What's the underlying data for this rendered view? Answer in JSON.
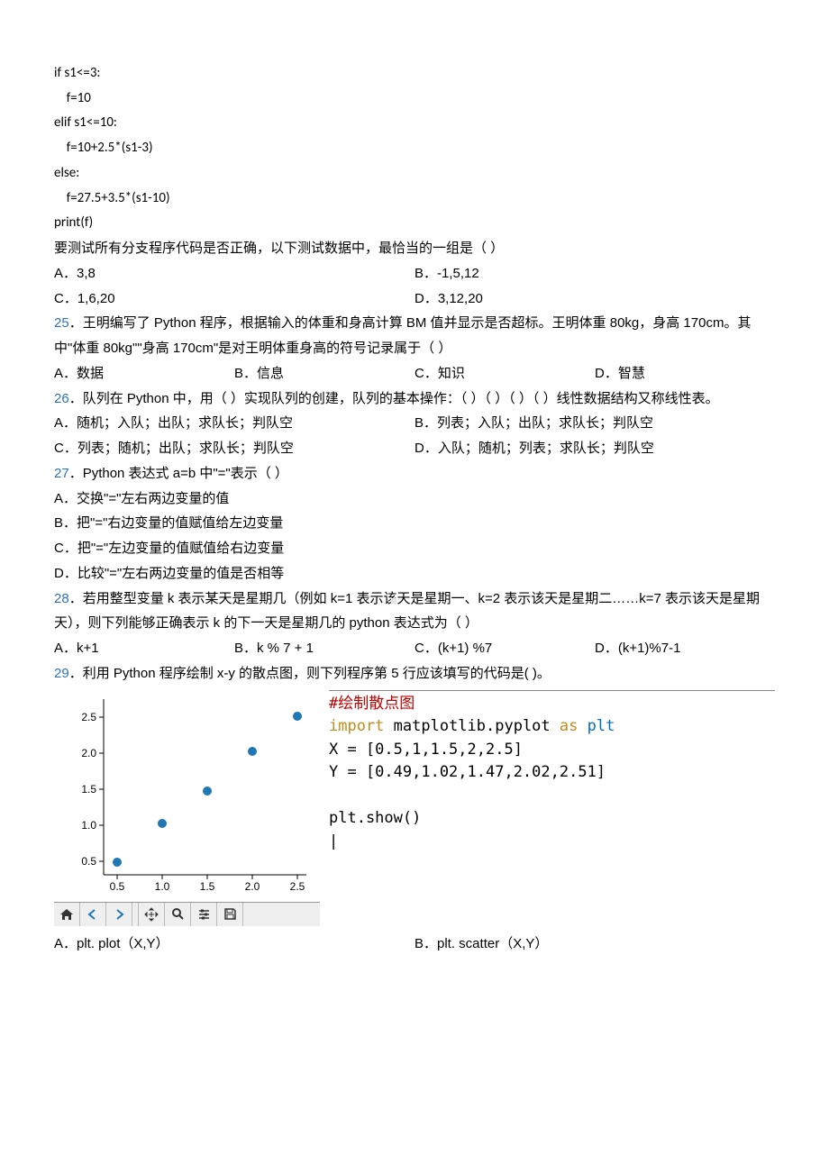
{
  "code24": {
    "l1": "if s1<=3:",
    "l2": "    f=10",
    "l3": "elif s1<=10:",
    "l4": "    f=10+2.5*(s1-3)",
    "l5": "else:",
    "l6": "    f=27.5+3.5*(s1-10)",
    "l7": "print(f)"
  },
  "q24_tail": "要测试所有分支程序代码是否正确，以下测试数据中，最恰当的一组是（   ）",
  "q24_opts": {
    "A": "A．3,8",
    "B": "B．-1,5,12",
    "C": "C．1,6,20",
    "D": "D．3,12,20"
  },
  "q25_num": "25",
  "q25_text": "．王明编写了 Python 程序，根据输入的体重和身高计算 BM 值并显示是否超标。王明体重 80kg，身高 170cm。其中\"体重 80kg\"\"身高 170cm\"是对王明体重身高的符号记录属于（   ）",
  "q25_opts": {
    "A": "A．数据",
    "B": "B．信息",
    "C": "C．知识",
    "D": "D．智慧"
  },
  "q26_num": "26",
  "q26_text": "．队列在 Python 中，用（ ）实现队列的创建，队列的基本操作：（ ）（ ）（ ）（ ）线性数据结构又称线性表。",
  "q26_opts": {
    "A": "A．随机；入队；出队；求队长；判队空",
    "B": "B．列表；入队；出队；求队长；判队空",
    "C": "C．列表；随机；出队；求队长；判队空",
    "D": "D．入队；随机；列表；求队长；判队空"
  },
  "q27_num": "27",
  "q27_text": "．Python 表达式 a=b 中\"=\"表示（      ）",
  "q27_opts": {
    "A": "A．交换\"=\"左右两边变量的值",
    "B": "B．把\"=\"右边变量的值赋值给左边变量",
    "C": "C．把\"=\"左边变量的值赋值给右边变量",
    "D": "D．比较\"=\"左右两边变量的值是否相等"
  },
  "q28_num": "28",
  "q28_text": "．若用整型变量 k 表示某天是星期几（例如 k=1 表示该天是星期一、k=2 表示该天是星期二……k=7 表示该天是星期天），则下列能够正确表示 k 的下一天是星期几的 python 表达式为（   ）",
  "q28_opts": {
    "A": "A．k+1",
    "B": "B．k % 7 + 1",
    "C": "C．(k+1) %7",
    "D": "D．(k+1)%7-1"
  },
  "q29_num": "29",
  "q29_text": "．利用 Python 程序绘制 x-y 的散点图，则下列程序第 5 行应该填写的代码是( )。",
  "q29_py": {
    "comment": "#绘制散点图",
    "imp1": "import",
    "imp2": " matplotlib.pyplot ",
    "imp3": "as",
    "imp4": " plt",
    "x": "X = [0.5,1,1.5,2,2.5]",
    "y": "Y = [0.49,1.02,1.47,2.02,2.51]",
    "blank": "",
    "show": "plt.show()",
    "cursor": "|"
  },
  "q29_opts": {
    "A": "A．plt. plot（X,Y）",
    "B": "B．plt. scatter（X,Y）"
  },
  "chart_data": {
    "type": "scatter",
    "x": [
      0.5,
      1.0,
      1.5,
      2.0,
      2.5
    ],
    "y": [
      0.49,
      1.02,
      1.47,
      2.02,
      2.51
    ],
    "x_ticks": [
      "0.5",
      "1.0",
      "1.5",
      "2.0",
      "2.5"
    ],
    "y_ticks": [
      "0.5",
      "1.0",
      "1.5",
      "2.0",
      "2.5"
    ],
    "xlim": [
      0.3,
      2.7
    ],
    "ylim": [
      0.3,
      2.7
    ]
  },
  "toolbar_icons": [
    "home-icon",
    "back-icon",
    "forward-icon",
    "spacer",
    "move-icon",
    "zoom-icon",
    "config-icon",
    "save-icon"
  ],
  "watermark": "■"
}
